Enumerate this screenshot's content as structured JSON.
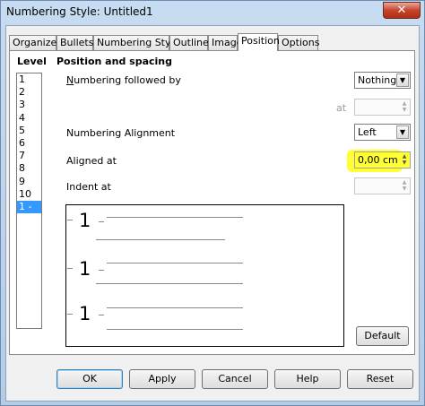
{
  "window": {
    "title": "Numbering Style: Untitled1",
    "close_glyph": "✕"
  },
  "tabs": [
    {
      "label": "Organizer"
    },
    {
      "label": "Bullets"
    },
    {
      "label": "Numbering Style"
    },
    {
      "label": "Outline"
    },
    {
      "label": "Image"
    },
    {
      "label": "Position"
    },
    {
      "label": "Options"
    }
  ],
  "active_tab": "Position",
  "level": {
    "heading": "Level",
    "items": [
      "1",
      "2",
      "3",
      "4",
      "5",
      "6",
      "7",
      "8",
      "9",
      "10",
      "1 - 10"
    ],
    "selected": "1 - 10"
  },
  "position": {
    "heading": "Position and spacing",
    "numbering_followed_by_label": "Numbering followed by",
    "numbering_followed_by_value": "Nothing",
    "at_label": "at",
    "at_value": "",
    "numbering_alignment_label": "Numbering Alignment",
    "numbering_alignment_value": "Left",
    "aligned_at_label": "Aligned at",
    "aligned_at_value": "0,00 cm",
    "indent_at_label": "Indent at",
    "indent_at_value": ""
  },
  "preview": {
    "numbers": [
      "1",
      "1",
      "1"
    ]
  },
  "buttons": {
    "default": "Default",
    "ok": "OK",
    "apply": "Apply",
    "cancel": "Cancel",
    "help": "Help",
    "reset": "Reset"
  },
  "colors": {
    "highlight": "#ffff33",
    "selection": "#3399ff"
  }
}
